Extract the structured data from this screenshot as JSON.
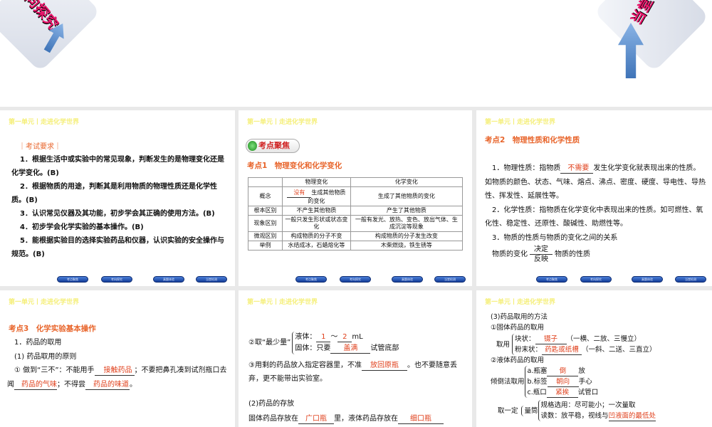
{
  "header": "第一单元丨走进化学世界",
  "nav": [
    "考点聚焦",
    "考向探究",
    "真题体验",
    "当堂检测"
  ],
  "top": {
    "left_banner": "向探究",
    "right_banner": "当堂"
  },
  "s1": {
    "title": "｜考试要求｜",
    "items": [
      "1．根据生活中或实验中的常见现象，判断发生的是物理变化还是化学变化。(B)",
      "2．根据物质的用途，判断其是利用物质的物理性质还是化学性质。(B)",
      "3．认识常见仪器及其功能，初步学会其正确的使用方法。(B)",
      "4．初步学会化学实验的基本操作。(B)",
      "5．能根据实验目的选择实验药品和仪器，认识实验的安全操作与规范。(B)"
    ]
  },
  "s2": {
    "badge": "考点聚焦",
    "title": "考点1　物理变化和化学变化",
    "cols": [
      "",
      "物理变化",
      "化学变化"
    ],
    "rows": [
      [
        "概念",
        "没有",
        "生成其他物质的变化",
        "生成了其他物质的变化"
      ],
      [
        "根本区别",
        "不产生其他物质",
        "产生了其他物质"
      ],
      [
        "现象区别",
        "一般只发生形状或状态变化",
        "一般有发光、放热、变色、放出气体、生成沉淀等现象"
      ],
      [
        "微观区别",
        "构成物质的分子不变",
        "构成物质的分子发生改变"
      ],
      [
        "举例",
        "水结成冰，石蜡熔化等",
        "木柴燃烧，铁生锈等"
      ]
    ]
  },
  "s3": {
    "title": "考点2　物理性质和化学性质",
    "p1a": "1．物理性质：指物质",
    "p1blank": "不需要",
    "p1b": "发生化学变化就表现出来的性质。如物质的颜色、状态、气味、熔点、沸点、密度、硬度、导电性、导热性、挥发性、延展性等。",
    "p2": "2．化学性质：指物质在化学变化中表现出来的性质。如可燃性、氧化性、稳定性、还原性、酸碱性、助燃性等。",
    "p3": "3．物质的性质与物质的变化之间的关系",
    "left": "物质的变化",
    "up": "决定",
    "down": "反映",
    "right": "物质的性质"
  },
  "s4": {
    "title": "考点3　化学实验基本操作",
    "l1": "1．药品的取用",
    "l2": "(1) 药品取用的原则",
    "l3a": "① 做到“三不”：不能用手",
    "b1": "接触药品",
    "l3b": "；不要把鼻孔凑到试剂瓶口去闻",
    "b2": "药品的气味",
    "l3c": "；不得尝",
    "b3": "药品的味道",
    "l3d": "。"
  },
  "s5": {
    "q": "②取“最少量”",
    "liq": "液体：",
    "v1": "1",
    "tilde": "～",
    "v2": "2",
    "unit": "mL",
    "sol": "固体：只要",
    "b1": "盖满",
    "sol2": "试管底部",
    "p3a": "③用剩的药品放入指定容器里，不准",
    "b2": "放回原瓶",
    "p3b": "。也不要随意丢弃，更不能带出实验室。",
    "h2": "(2)药品的存放",
    "p4a": "固体药品存放在",
    "b3": "广口瓶",
    "p4b": "里，液体药品存放在",
    "b4": "细口瓶"
  },
  "s6": {
    "h": "(3)药品取用的方法",
    "h1": "①固体药品的取用",
    "take": "取用",
    "r1a": "块状：",
    "r1b": "镊子",
    "r1c": "（一横、二放、三慢立）",
    "r2a": "粉末状：",
    "r2b": "药匙或纸槽",
    "r2c": "（一斜、二送、三直立）",
    "h2": "②液体药品的取用",
    "pour": "倾倒法取用",
    "a1": "a.瓶塞",
    "a2": "倒",
    "a3": "放",
    "b1": "b.标签",
    "b2": "朝向",
    "b3": "手心",
    "c1": "c.瓶口",
    "c2": "紧挨",
    "c3": "试管口",
    "q1": "取一定",
    "q2": "量筒",
    "q3": "规格选用：尽可能小；一次量取",
    "q4": "读数：放平稳，视线与",
    "q5": "凹液面的最低处"
  }
}
